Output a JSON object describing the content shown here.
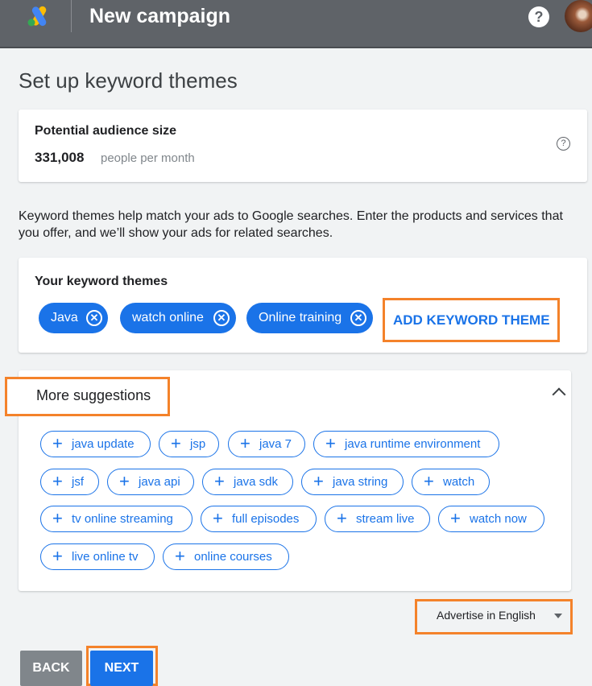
{
  "header": {
    "title": "New campaign",
    "help_label": "?"
  },
  "page": {
    "title": "Set up keyword themes"
  },
  "audience": {
    "label": "Potential audience size",
    "value": "331,008",
    "unit": "people per month",
    "info_icon": "?"
  },
  "description": "Keyword themes help match your ads to Google searches. Enter the products and services that you offer, and we’ll show your ads for related searches.",
  "themes": {
    "label": "Your keyword themes",
    "chips": [
      "Java",
      "watch online",
      "Online training"
    ],
    "add_label": "ADD KEYWORD THEME"
  },
  "suggestions": {
    "title": "More suggestions",
    "items": [
      "java update",
      "jsp",
      "java 7",
      "java runtime environment",
      "jsf",
      "java api",
      "java sdk",
      "java string",
      "watch",
      "tv online streaming",
      "full episodes",
      "stream live",
      "watch now",
      "live online tv",
      "online courses"
    ]
  },
  "language": {
    "prefix": "Advertise in",
    "value": "English"
  },
  "footer": {
    "back_label": "BACK",
    "next_label": "NEXT"
  },
  "colors": {
    "accent": "#1a73e8",
    "highlight": "#f4822a",
    "header_bg": "#5f6368"
  }
}
